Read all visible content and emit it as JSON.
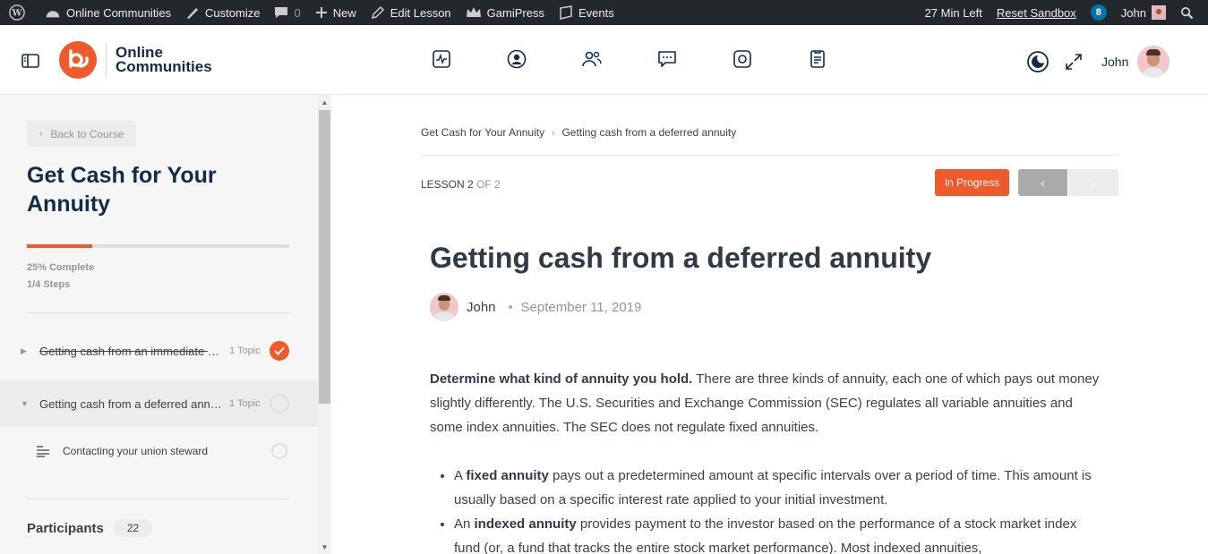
{
  "adminbar": {
    "site_name": "Online Communities",
    "customize": "Customize",
    "comments_count": "0",
    "new": "New",
    "edit_lesson": "Edit Lesson",
    "gamipress": "GamiPress",
    "events": "Events",
    "time_left": "27 Min Left",
    "reset_sandbox": "Reset Sandbox",
    "notifications_count": "8",
    "user": "John",
    "icons": [
      "wordpress-icon",
      "dashboard-icon",
      "brush-icon",
      "comment-icon",
      "plus-icon",
      "pencil-icon",
      "crown-icon",
      "events-icon",
      "search-icon"
    ]
  },
  "header": {
    "logo_line1": "Online",
    "logo_line2": "Communities",
    "nav_icons": [
      "activity-icon",
      "profile-icon",
      "members-icon",
      "messages-icon",
      "media-icon",
      "document-icon"
    ],
    "user_name": "John",
    "accent": "#ef5a2c"
  },
  "sidebar": {
    "back_label": "Back to Course",
    "course_title": "Get Cash for Your Annuity",
    "progress_fraction": 0.25,
    "progress_percent_text": "25% Complete",
    "progress_steps_text": "1/4 Steps",
    "lessons": [
      {
        "title": "Getting cash from an immediate annuity",
        "topics": "1 Topic",
        "completed": true
      },
      {
        "title": "Getting cash from a deferred annuity",
        "topics": "1 Topic",
        "completed": false
      }
    ],
    "topic": {
      "title": "Contacting your union steward"
    },
    "participants_label": "Participants",
    "participants_count": "22"
  },
  "main": {
    "breadcrumb": [
      "Get Cash for Your Annuity",
      "Getting cash from a deferred annuity"
    ],
    "lesson_label": "LESSON 2",
    "lesson_of": "OF 2",
    "status_button": "In Progress",
    "title": "Getting cash from a deferred annuity",
    "author": "John",
    "date": "September 11, 2019",
    "para_bold": "Determine what kind of annuity you hold.",
    "para_text": " There are three kinds of annuity, each one of which pays out money slightly differently. The U.S. Securities and Exchange Commission (SEC) regulates all variable annuities and some index annuities. The SEC does not regulate fixed annuities.",
    "bullets": [
      {
        "pre": "A ",
        "bold": "fixed annuity",
        "text": " pays out a predetermined amount at specific intervals over a period of time. This amount is usually based on a specific interest rate applied to your initial investment."
      },
      {
        "pre": "An ",
        "bold": "indexed annuity",
        "text": " provides payment to the investor based on the performance of a stock market index fund (or, a fund that tracks the entire stock market performance). Most indexed annuities,"
      }
    ]
  }
}
